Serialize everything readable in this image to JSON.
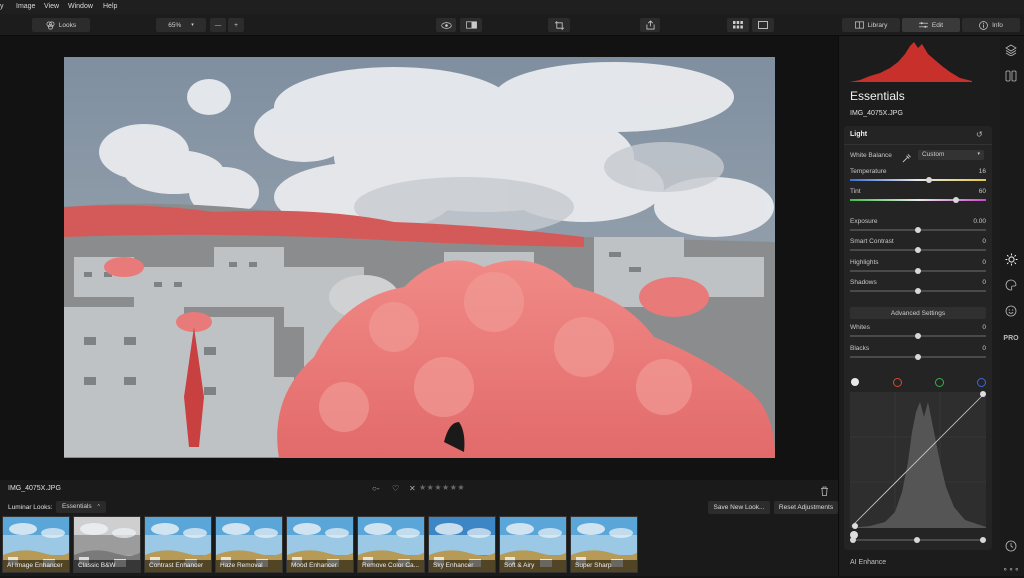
{
  "menu": [
    "y",
    "Image",
    "View",
    "Window",
    "Help"
  ],
  "toolbar": {
    "looks_label": "Looks",
    "zoom_value": "65%",
    "zoom_out": "—",
    "zoom_in": "+",
    "tabs": {
      "library": "Library",
      "edit": "Edit",
      "info": "Info"
    }
  },
  "image": {
    "filename": "IMG_4075X.JPG",
    "rating_stars": "★★★★★★",
    "flag_reject": "✕"
  },
  "looks": {
    "prefix": "Luminar Looks:",
    "category": "Essentials",
    "save_button": "Save New Look...",
    "reset_button": "Reset Adjustments",
    "items": [
      "AI Image Enhancer",
      "Classic B&W",
      "Contrast Enhancer",
      "Haze Removal",
      "Mood Enhancer",
      "Remove Color Ca...",
      "Sky Enhancer",
      "Soft & Airy",
      "Super Sharp"
    ]
  },
  "panel": {
    "title": "Essentials",
    "filename": "IMG_4075X.JPG",
    "section": "Light",
    "white_balance_label": "White Balance",
    "white_balance_value": "Custom",
    "sliders": [
      {
        "label": "Temperature",
        "value": "16",
        "pos": 0.58
      },
      {
        "label": "Tint",
        "value": "60",
        "pos": 0.78
      },
      {
        "label": "Exposure",
        "value": "0.00",
        "pos": 0.5
      },
      {
        "label": "Smart Contrast",
        "value": "0",
        "pos": 0.5
      },
      {
        "label": "Highlights",
        "value": "0",
        "pos": 0.5
      },
      {
        "label": "Shadows",
        "value": "0",
        "pos": 0.5
      }
    ],
    "advanced_label": "Advanced Settings",
    "adv_sliders": [
      {
        "label": "Whites",
        "value": "0",
        "pos": 0.5
      },
      {
        "label": "Blacks",
        "value": "0",
        "pos": 0.5
      }
    ],
    "next_section": "AI Enhance"
  },
  "colors": {
    "accent_red": "#c8302c",
    "foliage": "#ec7a7a",
    "sky": "#8e9aa8"
  }
}
